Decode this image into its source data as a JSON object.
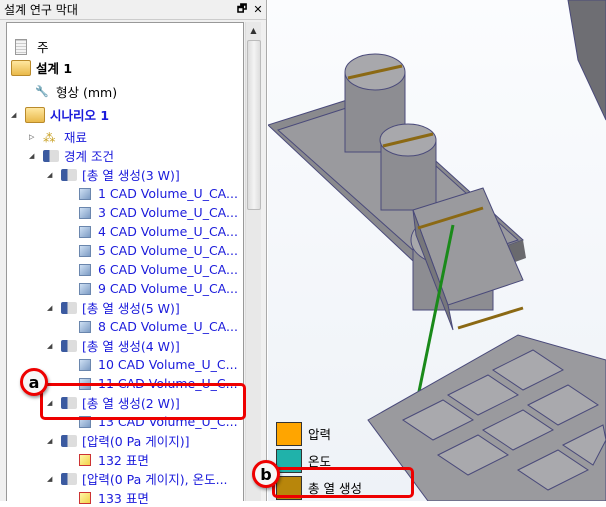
{
  "panel": {
    "title": "설계 연구 막대",
    "restore_icon": "restore-icon",
    "close_icon": "close-icon"
  },
  "tree": [
    {
      "label": "주",
      "icon": "notes-icon"
    },
    {
      "label": "설계 1",
      "icon": "design-folder-icon"
    },
    {
      "label": "형상 (mm)",
      "icon": "geometry-icon"
    },
    {
      "label": "시나리오 1",
      "icon": "scenario-folder-icon"
    },
    {
      "label": "재료",
      "icon": "materials-icon"
    },
    {
      "label": "경계 조건",
      "icon": "boundary-icon"
    },
    {
      "label": "[총 열 생성(3 W)]",
      "icon": "load-icon"
    },
    {
      "label": "1 CAD Volume_U_CA...",
      "icon": "volume-icon"
    },
    {
      "label": "3 CAD Volume_U_CA...",
      "icon": "volume-icon"
    },
    {
      "label": "4 CAD Volume_U_CA...",
      "icon": "volume-icon"
    },
    {
      "label": "5 CAD Volume_U_CA...",
      "icon": "volume-icon"
    },
    {
      "label": "6 CAD Volume_U_CA...",
      "icon": "volume-icon"
    },
    {
      "label": "9 CAD Volume_U_CA...",
      "icon": "volume-icon"
    },
    {
      "label": "[총 열 생성(5 W)]",
      "icon": "load-icon"
    },
    {
      "label": "8 CAD Volume_U_CA...",
      "icon": "volume-icon"
    },
    {
      "label": "[총 열 생성(4 W)]",
      "icon": "load-icon"
    },
    {
      "label": "10 CAD Volume_U_C...",
      "icon": "volume-icon"
    },
    {
      "label": "11 CAD Volume_U_C...",
      "icon": "volume-icon"
    },
    {
      "label": "[총 열 생성(2 W)]",
      "icon": "load-icon"
    },
    {
      "label": "13 CAD Volume_U_C...",
      "icon": "volume-icon"
    },
    {
      "label": "[압력(0 Pa 게이지)]",
      "icon": "load-icon"
    },
    {
      "label": "132 표면",
      "icon": "surface-icon"
    },
    {
      "label": "[압력(0 Pa 게이지), 온도...",
      "icon": "load-icon"
    },
    {
      "label": "133 표면",
      "icon": "surface-icon"
    }
  ],
  "callouts": {
    "a": "a",
    "b": "b"
  },
  "legend": [
    {
      "label": "압력",
      "color": "#FFA500"
    },
    {
      "label": "온도",
      "color": "#20B2AA"
    },
    {
      "label": "총 열 생성",
      "color": "#B8860B"
    }
  ]
}
